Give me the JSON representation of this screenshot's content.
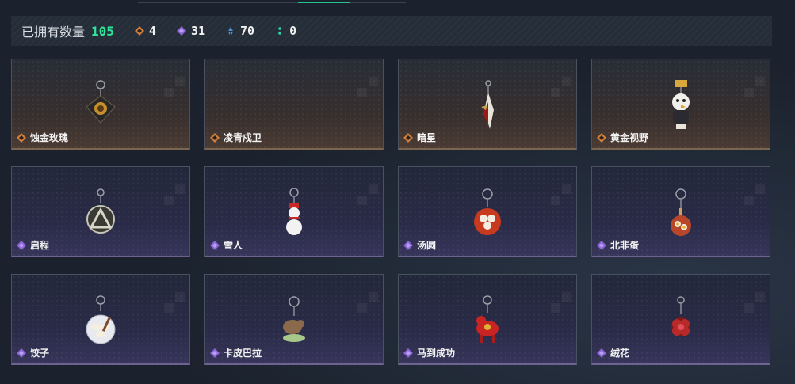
{
  "summary": {
    "owned_label": "已拥有数量",
    "owned_total": "105",
    "stats": [
      {
        "icon": "orange-diamond-icon",
        "color": "#d0803c",
        "value": "4"
      },
      {
        "icon": "purple-diamond-icon",
        "color": "#8a66d6",
        "value": "31"
      },
      {
        "icon": "blue-shard-icon",
        "color": "#4f8fd6",
        "value": "70"
      },
      {
        "icon": "green-dots-icon",
        "color": "#2fd4a8",
        "value": "0"
      }
    ]
  },
  "items": [
    {
      "name": "蚀金玫瑰",
      "rarity": "gold"
    },
    {
      "name": "凌青戍卫",
      "rarity": "gold"
    },
    {
      "name": "暗星",
      "rarity": "gold"
    },
    {
      "name": "黄金视野",
      "rarity": "gold"
    },
    {
      "name": "启程",
      "rarity": "purple"
    },
    {
      "name": "雪人",
      "rarity": "purple"
    },
    {
      "name": "汤圆",
      "rarity": "purple"
    },
    {
      "name": "北非蛋",
      "rarity": "purple"
    },
    {
      "name": "饺子",
      "rarity": "purple"
    },
    {
      "name": "卡皮巴拉",
      "rarity": "purple"
    },
    {
      "name": "马到成功",
      "rarity": "purple"
    },
    {
      "name": "绒花",
      "rarity": "purple"
    }
  ],
  "colors": {
    "accent_green": "#2fe39a",
    "gold_icon": "#d0803c",
    "purple_icon": "#8a66d6"
  }
}
